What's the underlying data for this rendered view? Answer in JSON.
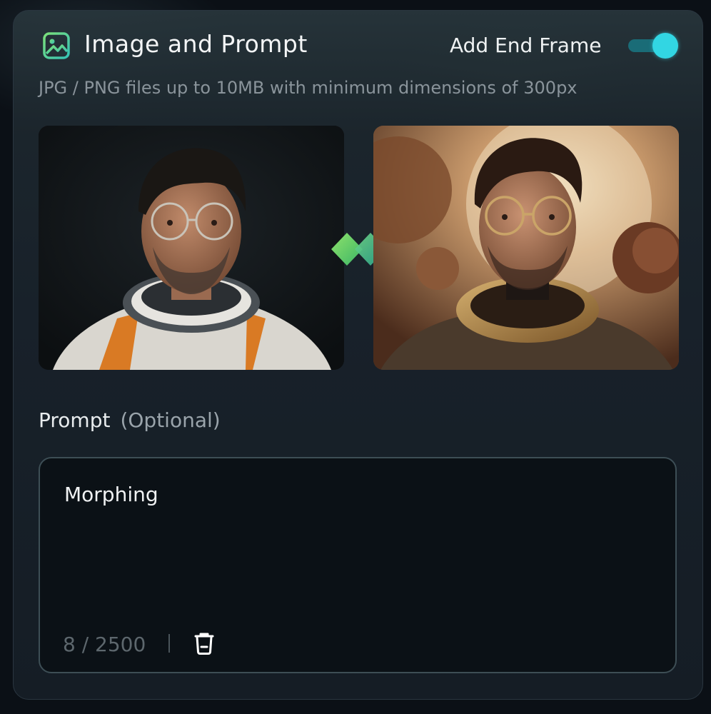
{
  "header": {
    "title": "Image and Prompt",
    "icon": "image-icon",
    "end_frame_toggle": {
      "label": "Add End Frame",
      "on": true,
      "accent": "#32d6e3"
    },
    "subtitle": "JPG / PNG files up to 10MB with minimum dimensions of 300px"
  },
  "frames": {
    "start": {
      "kind": "portrait photo - man in white and orange spacesuit"
    },
    "end": {
      "kind": "portrait photo - man in bronze spacesuit with planets"
    },
    "link_icon": "double-diamond-icon"
  },
  "prompt": {
    "label": "Prompt",
    "optional_note": "(Optional)",
    "value": "Morphing",
    "counter": "8 / 2500",
    "clear_icon": "trash-icon"
  },
  "colors": {
    "panel": "#18212a",
    "accent": "#32d6e3",
    "icon_green": "#5fd06a"
  }
}
